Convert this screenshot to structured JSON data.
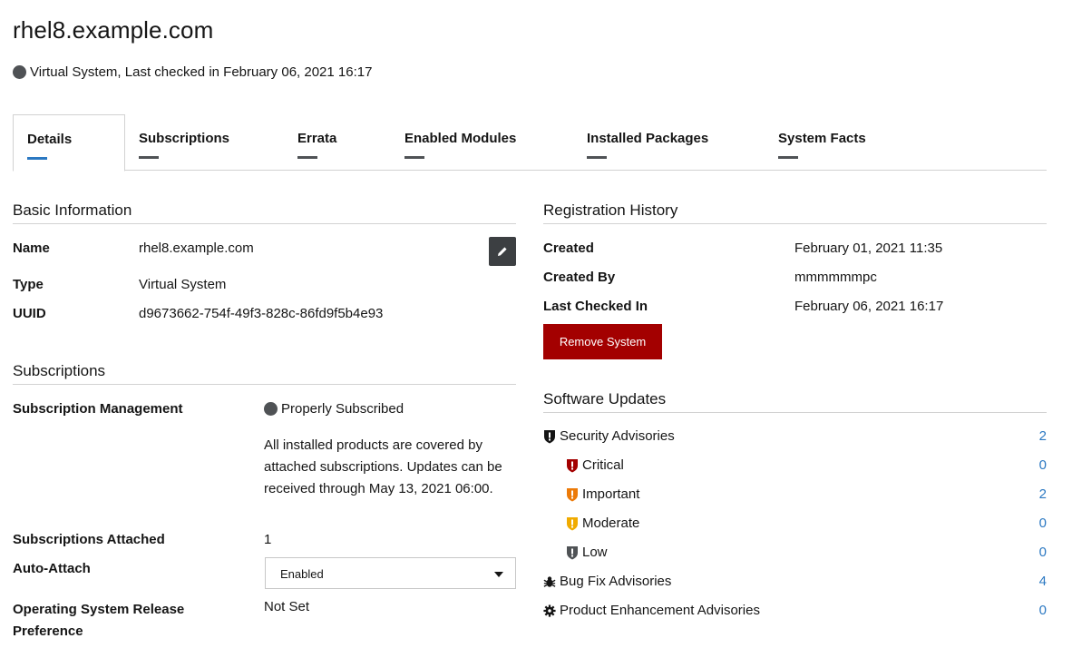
{
  "header": {
    "hostname": "rhel8.example.com",
    "status_text": "Virtual System, Last checked in February 06, 2021 16:17"
  },
  "tabs": [
    {
      "label": "Details",
      "active": true
    },
    {
      "label": "Subscriptions"
    },
    {
      "label": "Errata"
    },
    {
      "label": "Enabled Modules"
    },
    {
      "label": "Installed Packages"
    },
    {
      "label": "System Facts"
    }
  ],
  "basic_info": {
    "title": "Basic Information",
    "name_label": "Name",
    "name_value": "rhel8.example.com",
    "type_label": "Type",
    "type_value": "Virtual System",
    "uuid_label": "UUID",
    "uuid_value": "d9673662-754f-49f3-828c-86fd9f5b4e93",
    "edit_icon": "pencil-icon"
  },
  "subscriptions": {
    "title": "Subscriptions",
    "mgmt_label": "Subscription Management",
    "mgmt_status": "Properly Subscribed",
    "mgmt_description": "All installed products are covered by attached subscriptions. Updates can be received through May 13, 2021 06:00.",
    "attached_label": "Subscriptions Attached",
    "attached_value": "1",
    "auto_attach_label": "Auto-Attach",
    "auto_attach_value": "Enabled",
    "os_release_label_line1": "Operating System Release",
    "os_release_label_line2": "Preference",
    "os_release_value": "Not Set"
  },
  "registration": {
    "title": "Registration History",
    "created_label": "Created",
    "created_value": "February 01, 2021 11:35",
    "created_by_label": "Created By",
    "created_by_value": "mmmmmmpc",
    "last_checked_label": "Last Checked In",
    "last_checked_value": "February 06, 2021 16:17",
    "remove_button": "Remove System"
  },
  "software_updates": {
    "title": "Software Updates",
    "security_label": "Security Advisories",
    "security_count": "2",
    "critical_label": "Critical",
    "critical_count": "0",
    "important_label": "Important",
    "important_count": "2",
    "moderate_label": "Moderate",
    "moderate_count": "0",
    "low_label": "Low",
    "low_count": "0",
    "bugfix_label": "Bug Fix Advisories",
    "bugfix_count": "4",
    "enhancement_label": "Product Enhancement Advisories",
    "enhancement_count": "0"
  },
  "colors": {
    "link": "#2b78c2",
    "danger": "#a30000",
    "critical": "#a30000",
    "important": "#ec7a08",
    "moderate": "#f0ab00",
    "low": "#4f5255"
  }
}
